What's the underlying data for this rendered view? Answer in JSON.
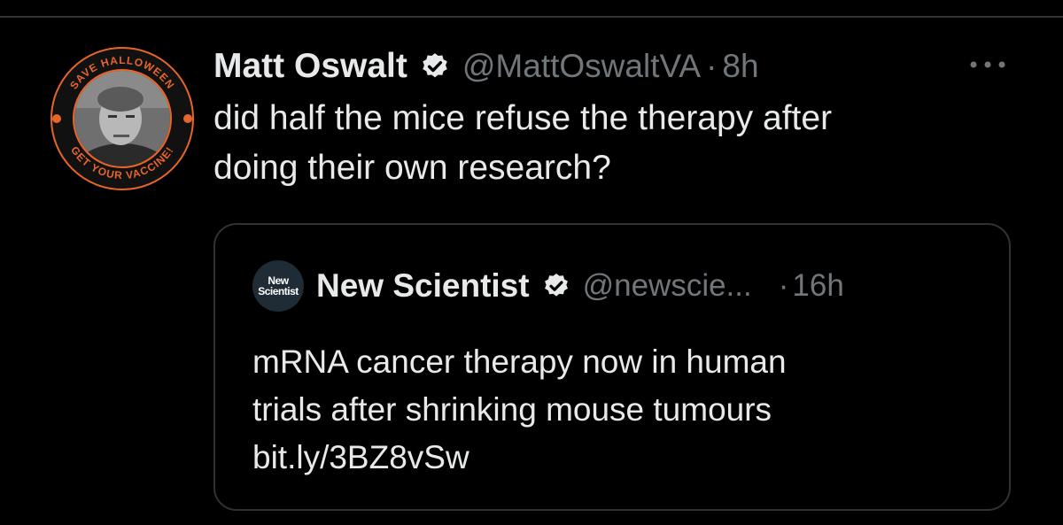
{
  "tweet": {
    "author_name": "Matt Oswalt",
    "handle": "@MattOswaltVA",
    "separator": "·",
    "time": "8h",
    "text_line1": "did half the mice refuse the therapy after",
    "text_line2": "doing their own research?",
    "avatar_ring_top": "SAVE HALLOWEEN",
    "avatar_ring_bottom": "GET YOUR VACCINE!"
  },
  "quote": {
    "logo_line1": "New",
    "logo_line2": "Scientist",
    "author_name": "New Scientist",
    "handle": "@newscie...",
    "separator": "·",
    "time": "16h",
    "text_line1": "mRNA cancer therapy now in human",
    "text_line2": "trials after shrinking mouse tumours",
    "link": "bit.ly/3BZ8vSw"
  },
  "colors": {
    "background": "#000000",
    "text_primary": "#e7e9ea",
    "text_secondary": "#71767b",
    "border": "#2f3336",
    "avatar_ring": "#e8652a"
  },
  "icons": {
    "verified": "verified-badge-icon",
    "more": "more-options-icon"
  }
}
